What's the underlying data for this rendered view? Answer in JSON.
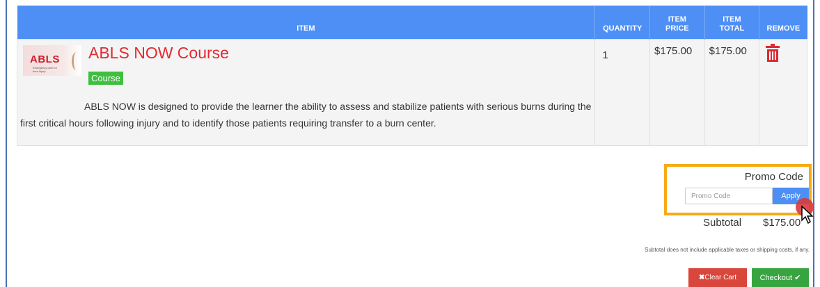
{
  "table": {
    "headers": {
      "item": "ITEM",
      "quantity": "QUANTITY",
      "item_price": "ITEM PRICE",
      "item_total": "ITEM TOTAL",
      "remove": "REMOVE"
    },
    "rows": [
      {
        "thumbnail_text": "ABLS",
        "thumbnail_tagline": "Emergency care for burn injury",
        "title": "ABLS NOW Course",
        "badge": "Course",
        "description": "ABLS NOW is designed to provide the learner the ability to assess and stabilize patients with serious burns during the first critical hours following injury and to identify those patients requiring transfer to a burn center.",
        "quantity": "1",
        "price": "$175.00",
        "total": "$175.00",
        "remove_icon": "trash-icon"
      }
    ]
  },
  "promo": {
    "label": "Promo Code",
    "placeholder": "Promo Code",
    "apply_label": "Apply"
  },
  "summary": {
    "subtotal_label": "Subtotal",
    "subtotal_value": "$175.00",
    "disclaimer": "Subtotal does not include applicable taxes or shipping costs, if any."
  },
  "actions": {
    "clear_label": "Clear Cart",
    "checkout_label": "Checkout"
  },
  "colors": {
    "header_bg": "#4d8ff5",
    "title_red": "#e02a31",
    "badge_green": "#3fbf3f",
    "highlight_orange": "#f5ab17",
    "clear_red": "#d9463b",
    "checkout_green": "#37a53f"
  }
}
